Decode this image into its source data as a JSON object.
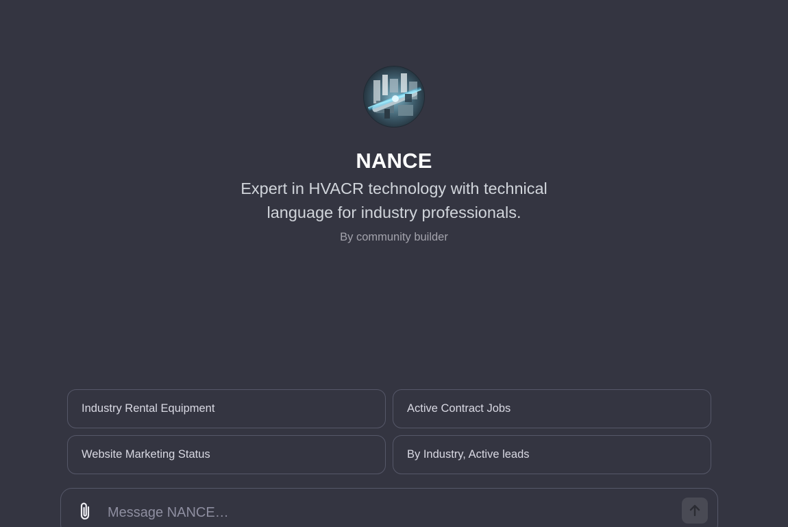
{
  "gpt": {
    "name": "NANCE",
    "description": "Expert in HVACR technology with technical language for industry professionals.",
    "author": "By community builder",
    "avatar_icon": "hvacr-tech-avatar"
  },
  "starters": [
    {
      "label": "Industry Rental Equipment"
    },
    {
      "label": "Active Contract Jobs"
    },
    {
      "label": "Website Marketing Status"
    },
    {
      "label": "By Industry, Active leads"
    }
  ],
  "composer": {
    "placeholder": "Message NANCE…",
    "value": "",
    "attach_icon": "paperclip-icon",
    "send_icon": "arrow-up-icon"
  },
  "colors": {
    "background": "#343541",
    "border": "#565869",
    "send_button": "#494a54"
  }
}
